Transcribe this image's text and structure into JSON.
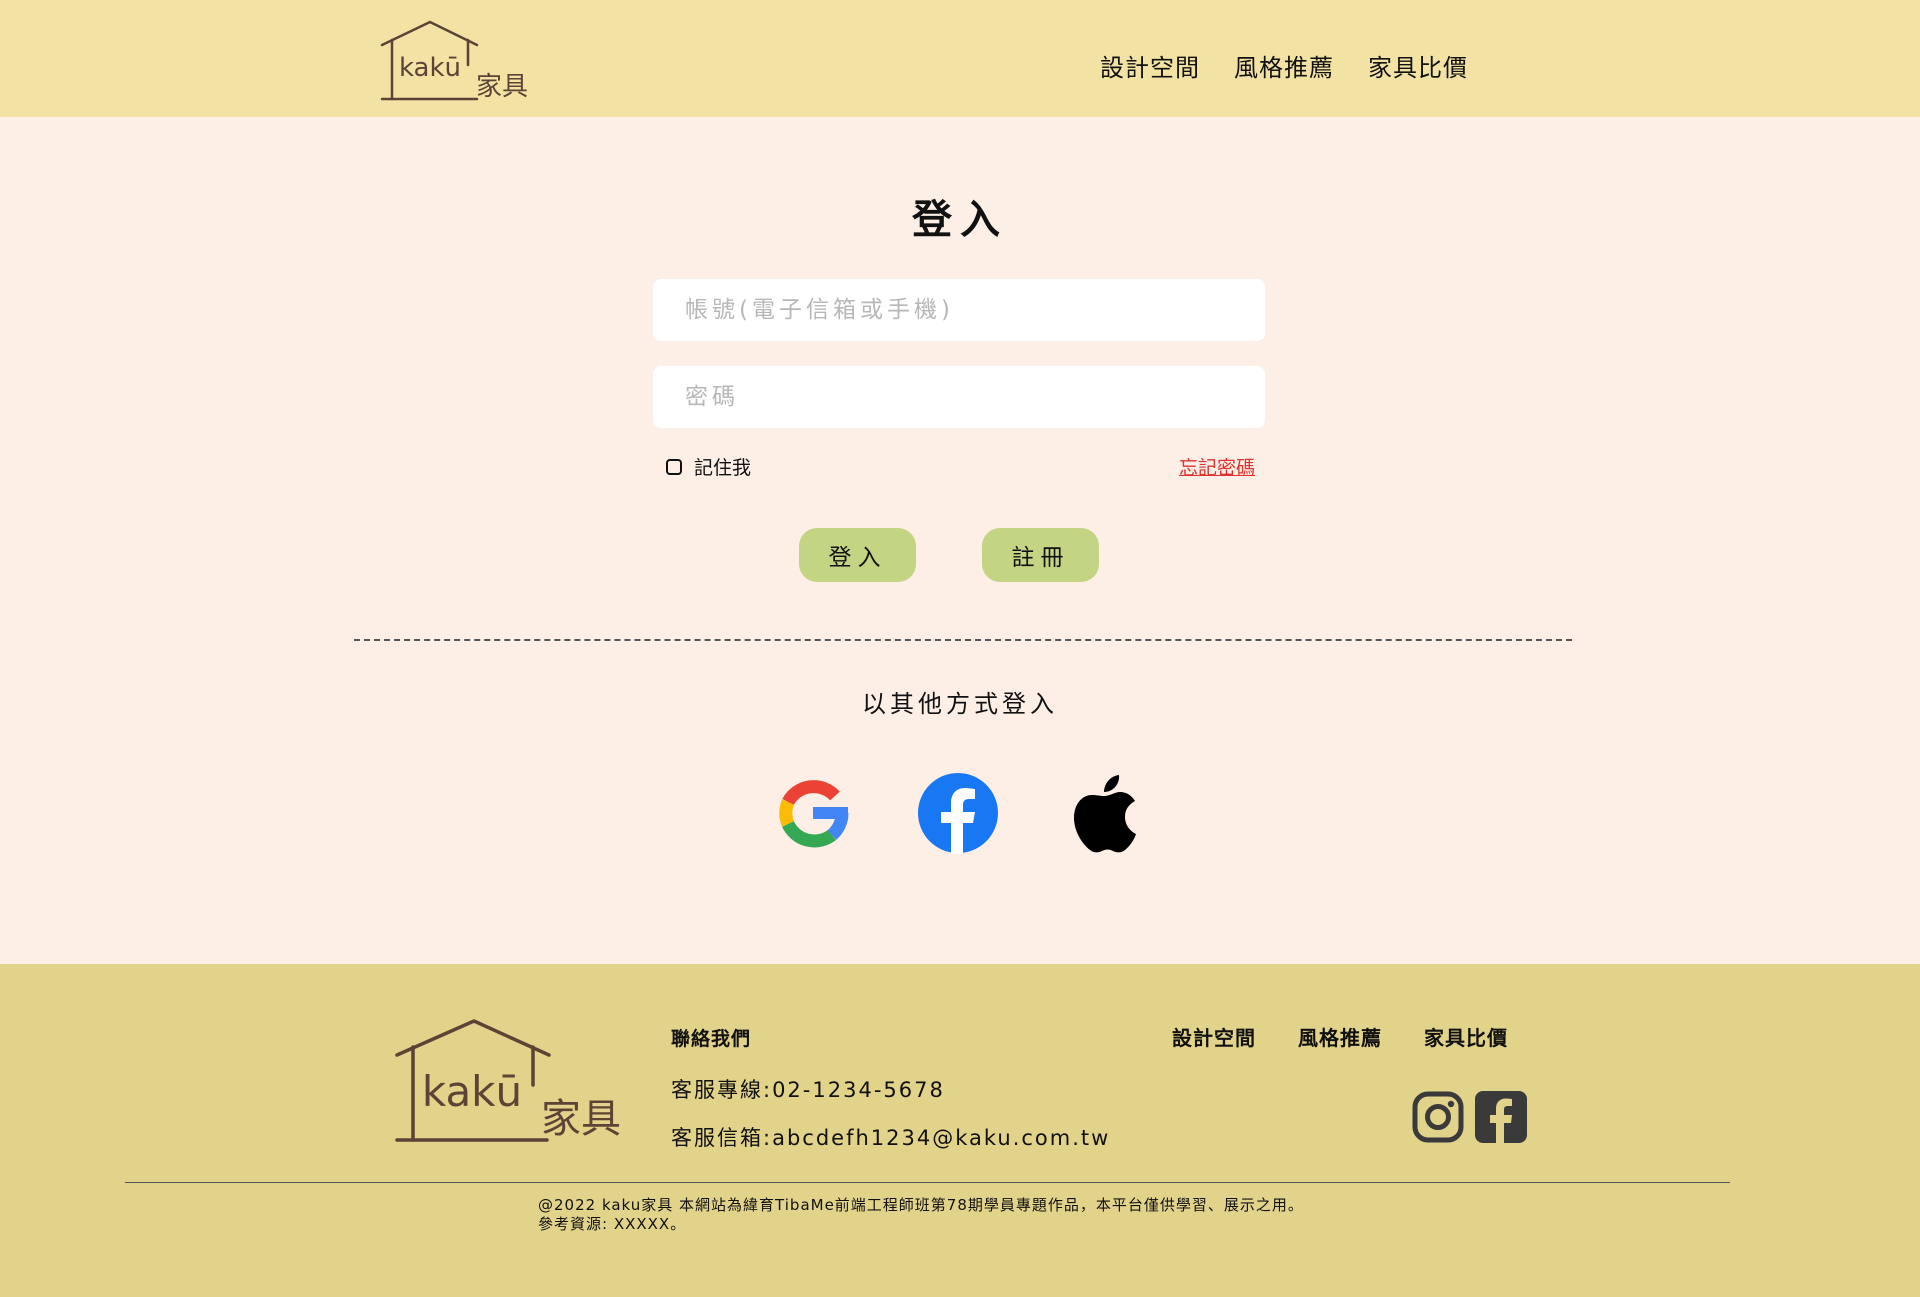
{
  "brand": {
    "name": "kakū",
    "suffix": "家具"
  },
  "nav": {
    "items": [
      "設計空間",
      "風格推薦",
      "家具比價"
    ]
  },
  "login": {
    "title": "登入",
    "account_placeholder": "帳號(電子信箱或手機)",
    "password_placeholder": "密碼",
    "remember_label": "記住我",
    "forgot_label": "忘記密碼",
    "login_button": "登入",
    "register_button": "註冊",
    "alt_login_label": "以其他方式登入"
  },
  "social_login": [
    "google-icon",
    "facebook-icon",
    "apple-icon"
  ],
  "footer": {
    "contact_title": "聯絡我們",
    "phone": "客服專線:02-1234-5678",
    "email": "客服信箱:abcdefh1234@kaku.com.tw",
    "nav": [
      "設計空間",
      "風格推薦",
      "家具比價"
    ],
    "social": [
      "instagram-icon",
      "facebook-icon"
    ],
    "copyright_line1": "@2022 kaku家具 本網站為緯育TibaMe前端工程師班第78期學員專題作品，本平台僅供學習、展示之用。",
    "copyright_line2": "參考資源: XXXXX。"
  },
  "colors": {
    "header_bg": "#f2e3a4",
    "main_bg": "#fdefe6",
    "footer_bg": "#e2d38b",
    "button_bg": "#c3d483",
    "forgot_link": "#e0312e",
    "logo_stroke": "#5b4336"
  }
}
